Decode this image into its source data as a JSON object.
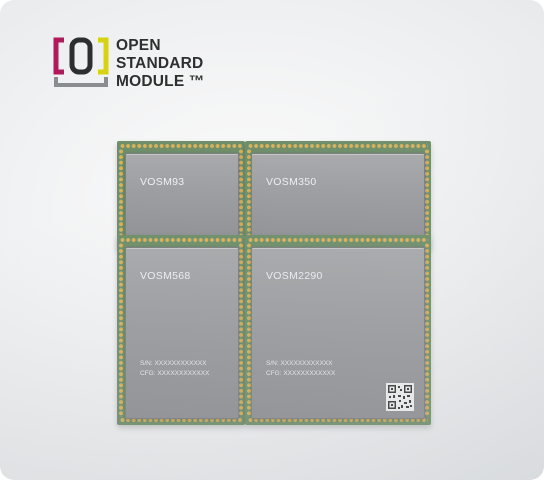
{
  "logo": {
    "line1": "OPEN",
    "line2": "STANDARD",
    "line3": "MODULE ™",
    "mark_colors": {
      "left_bracket": "#b0195a",
      "center": "#2e2e2e",
      "right_bracket": "#d7d313",
      "bottom": "#8a8d90"
    }
  },
  "modules": [
    {
      "name": "VOSM93"
    },
    {
      "name": "VOSM350"
    },
    {
      "name": "VOSM568",
      "sn": "S/N: XXXXXXXXXXXX",
      "cfg": "CFG: XXXXXXXXXXXX"
    },
    {
      "name": "VOSM2290",
      "sn": "S/N: XXXXXXXXXXXX",
      "cfg": "CFG: XXXXXXXXXXXX",
      "qr_icon": "qr-code-icon"
    }
  ],
  "colors": {
    "pcb_green": "#6f8f6a",
    "pad_gold": "#d6b25e",
    "shield_gray": "#9d9ea1"
  }
}
